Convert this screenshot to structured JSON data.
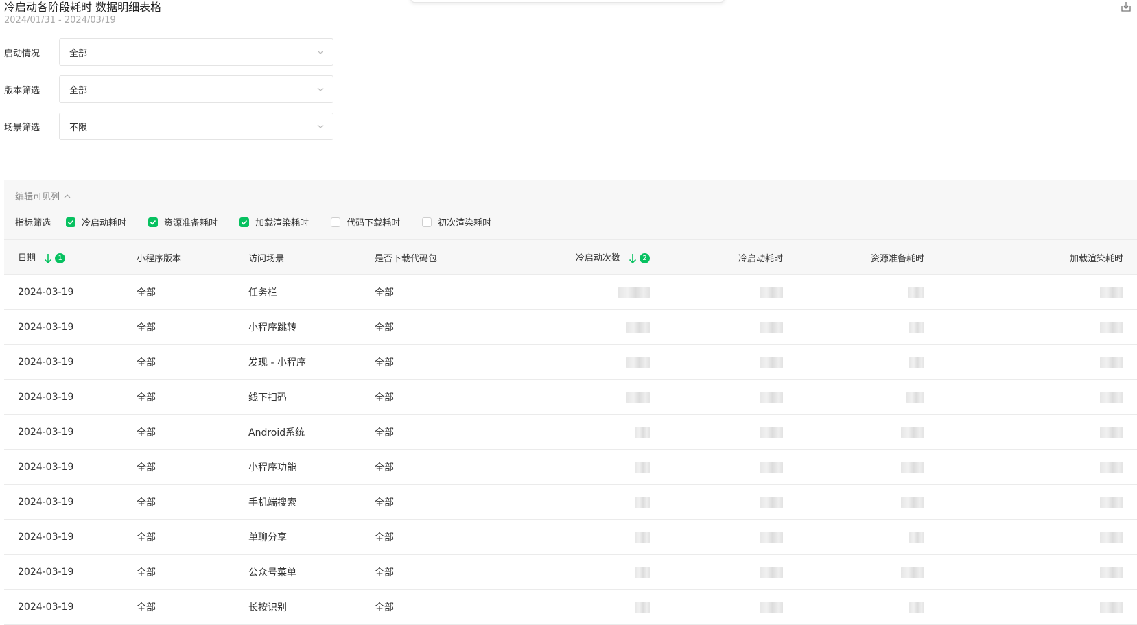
{
  "page": {
    "title": "冷启动各阶段耗时 数据明细表格",
    "date_range": "2024/01/31 - 2024/03/19"
  },
  "filters": [
    {
      "label": "启动情况",
      "value": "全部"
    },
    {
      "label": "版本筛选",
      "value": "全部"
    },
    {
      "label": "场景筛选",
      "value": "不限"
    }
  ],
  "columns_panel": {
    "edit_label": "编辑可见列",
    "metric_label": "指标筛选",
    "metrics": [
      {
        "label": "冷启动耗时",
        "checked": true
      },
      {
        "label": "资源准备耗时",
        "checked": true
      },
      {
        "label": "加载渲染耗时",
        "checked": true
      },
      {
        "label": "代码下载耗时",
        "checked": false
      },
      {
        "label": "初次渲染耗时",
        "checked": false
      }
    ]
  },
  "table": {
    "headers": {
      "date": "日期",
      "date_sort_order": "1",
      "version": "小程序版本",
      "scene": "访问场景",
      "download": "是否下载代码包",
      "cold_count": "冷启动次数",
      "cold_count_sort_order": "2",
      "cold_time": "冷启动耗时",
      "resource_time": "资源准备耗时",
      "render_time": "加载渲染耗时"
    },
    "rows": [
      {
        "date": "2024-03-19",
        "version": "全部",
        "scene": "任务栏",
        "download": "全部"
      },
      {
        "date": "2024-03-19",
        "version": "全部",
        "scene": "小程序跳转",
        "download": "全部"
      },
      {
        "date": "2024-03-19",
        "version": "全部",
        "scene": "发现 - 小程序",
        "download": "全部"
      },
      {
        "date": "2024-03-19",
        "version": "全部",
        "scene": "线下扫码",
        "download": "全部"
      },
      {
        "date": "2024-03-19",
        "version": "全部",
        "scene": "Android系统",
        "download": "全部"
      },
      {
        "date": "2024-03-19",
        "version": "全部",
        "scene": "小程序功能",
        "download": "全部"
      },
      {
        "date": "2024-03-19",
        "version": "全部",
        "scene": "手机端搜索",
        "download": "全部"
      },
      {
        "date": "2024-03-19",
        "version": "全部",
        "scene": "单聊分享",
        "download": "全部"
      },
      {
        "date": "2024-03-19",
        "version": "全部",
        "scene": "公众号菜单",
        "download": "全部"
      },
      {
        "date": "2024-03-19",
        "version": "全部",
        "scene": "长按识别",
        "download": "全部"
      }
    ]
  },
  "icons": {
    "export": "export-icon",
    "chevron": "chevron-down-icon",
    "collapse": "chevron-up-icon",
    "check": "check-icon",
    "sort": "arrow-down-icon"
  },
  "colors": {
    "accent": "#07c160",
    "panel_bg": "#f7f7f7"
  }
}
